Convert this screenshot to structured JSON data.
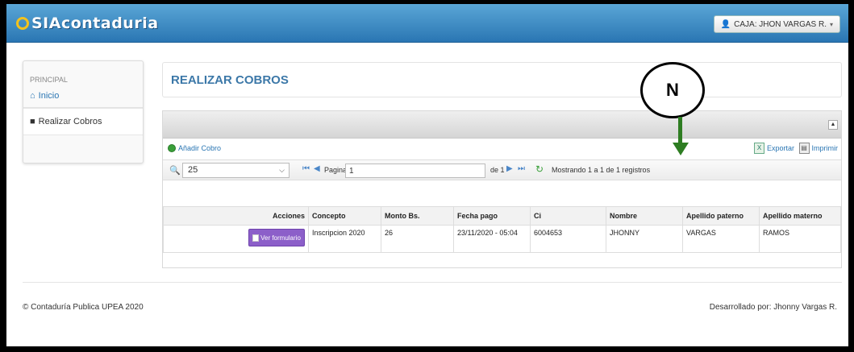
{
  "navbar": {
    "brand": "SIAcontaduria",
    "user_label": "CAJA: JHON VARGAS R.",
    "caret": "▾"
  },
  "sidebar": {
    "header": "PRINCIPAL",
    "items": [
      {
        "label": "Inicio",
        "icon": "home-icon"
      },
      {
        "label": "Realizar Cobros",
        "icon": "folder-icon"
      }
    ]
  },
  "main": {
    "title": "REALIZAR COBROS",
    "toolbar": {
      "add_label": "Añadir Cobro",
      "export_label": "Exportar",
      "print_label": "Imprimir"
    },
    "pager": {
      "rows_per_page": "25",
      "page_label": "Pagina",
      "page_value": "1",
      "of_label": "de 1",
      "records_info": "Mostrando 1 a 1 de 1 registros"
    },
    "table": {
      "columns": [
        "Acciones",
        "Concepto",
        "Monto Bs.",
        "Fecha pago",
        "Ci",
        "Nombre",
        "Apellido paterno",
        "Apellido materno"
      ],
      "rows": [
        {
          "action": "Ver formulario",
          "concepto": "Inscripcion 2020",
          "monto": "26",
          "fecha": "23/11/2020 - 05:04",
          "ci": "6004653",
          "nombre": "JHONNY",
          "apellido_paterno": "VARGAS",
          "apellido_materno": "RAMOS"
        }
      ]
    }
  },
  "footer": {
    "left": "© Contaduría Publica UPEA 2020",
    "right": "Desarrollado por: Jhonny Vargas R."
  },
  "annotation": {
    "label": "N",
    "arrow_color": "#2e7d22"
  },
  "colors": {
    "navbar": "#2a76b3",
    "title": "#3c78a8",
    "button": "#8c5fc9"
  }
}
